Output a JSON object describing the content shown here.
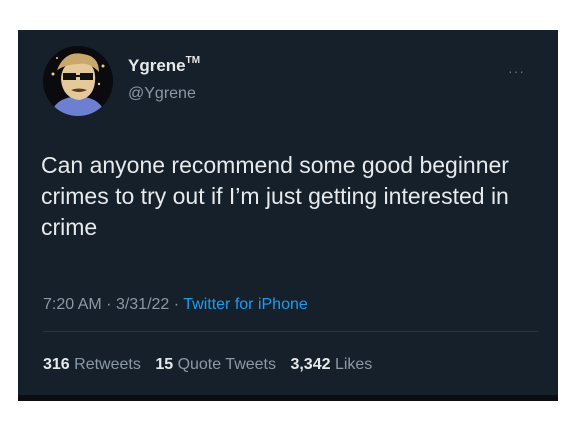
{
  "tweet": {
    "display_name": "Ygrene",
    "tm_mark": "TM",
    "handle": "@Ygrene",
    "more_glyph": "···",
    "text": "Can anyone recommend some good beginner crimes to try out if I’m just getting interested in crime",
    "time": "7:20 AM",
    "date": "3/31/22",
    "separator": "·",
    "source": "Twitter for iPhone",
    "stats": {
      "retweets_count": "316",
      "retweets_label": "Retweets",
      "quote_count": "15",
      "quote_label": "Quote Tweets",
      "likes_count": "3,342",
      "likes_label": "Likes"
    }
  },
  "colors": {
    "background": "#15202b",
    "text": "#e7e9ea",
    "muted": "#8b98a5",
    "link": "#1d9bf0"
  }
}
